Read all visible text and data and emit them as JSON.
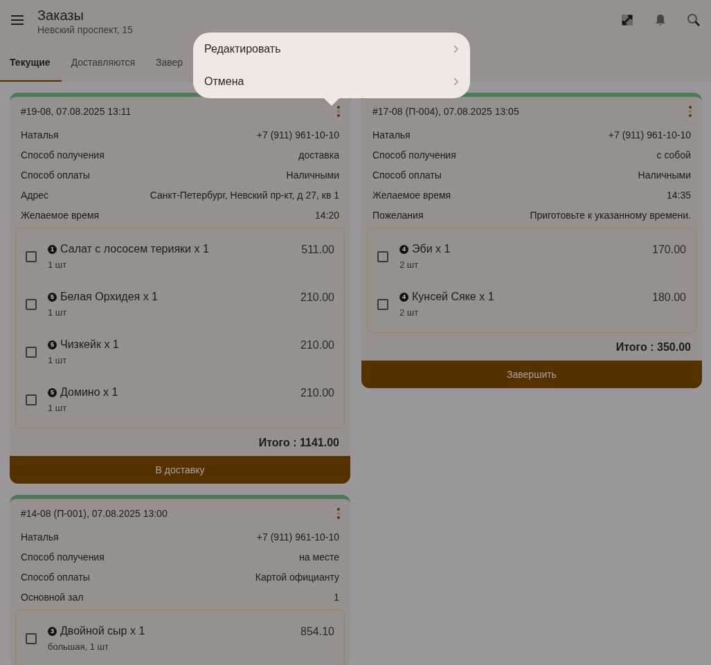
{
  "app_bar": {
    "title": "Заказы",
    "subtitle": "Невский проспект, 15"
  },
  "tabs": [
    {
      "label": "Текущие",
      "selected": true
    },
    {
      "label": "Доставляются",
      "selected": false
    },
    {
      "label": "Завер",
      "selected": false
    }
  ],
  "menu": {
    "items": [
      "Редактировать",
      "Отмена"
    ]
  },
  "columns": [
    [
      {
        "header": "#19-08, 07.08.2025 13:11",
        "fields": [
          {
            "label": "Наталья",
            "value": "+7 (911) 961-10-10"
          },
          {
            "label": "Способ получения",
            "value": "доставка"
          },
          {
            "label": "Способ оплаты",
            "value": "Наличными"
          },
          {
            "label": "Адрес",
            "value": "Санкт-Петербург, Невский пр-кт, д 27, кв 1"
          },
          {
            "label": "Желаемое время",
            "value": "14:20"
          }
        ],
        "items": [
          {
            "badge": "1",
            "name": "Салат с лососем терияки x 1",
            "details": "1 шт",
            "price": "511.00",
            "checked": false
          },
          {
            "badge": "5",
            "name": "Белая Орхидея x 1",
            "details": "1 шт",
            "price": "210.00",
            "checked": false
          },
          {
            "badge": "5",
            "name": "Чизкейк x 1",
            "details": "1 шт",
            "price": "210.00",
            "checked": false
          },
          {
            "badge": "5",
            "name": "Домино x 1",
            "details": "1 шт",
            "price": "210.00",
            "checked": false
          }
        ],
        "total": "Итого : 1141.00",
        "action": "В доставку"
      },
      {
        "header": "#14-08 (П-001), 07.08.2025 13:00",
        "fields": [
          {
            "label": "Наталья",
            "value": "+7 (911) 961-10-10"
          },
          {
            "label": "Способ получения",
            "value": "на месте"
          },
          {
            "label": "Способ оплаты",
            "value": "Картой официанту"
          },
          {
            "label": "Основной зал",
            "value": "1"
          }
        ],
        "items": [
          {
            "badge": "3",
            "name": "Двойной сыр x 1",
            "details": "большая, 1 шт",
            "price": "854.10",
            "checked": false
          }
        ]
      }
    ],
    [
      {
        "header": "#17-08 (П-004), 07.08.2025 13:05",
        "fields": [
          {
            "label": "Наталья",
            "value": "+7 (911) 961-10-10"
          },
          {
            "label": "Способ получения",
            "value": "с собой"
          },
          {
            "label": "Способ оплаты",
            "value": "Наличными"
          },
          {
            "label": "Желаемое время",
            "value": "14:35"
          },
          {
            "label": "Пожелания",
            "value": "Приготовьте к указанному времени."
          }
        ],
        "items": [
          {
            "badge": "4",
            "name": "Эби x 1",
            "details": "2 шт",
            "price": "170.00",
            "checked": false
          },
          {
            "badge": "4",
            "name": "Кунсей Сяке x 1",
            "details": "2 шт",
            "price": "180.00",
            "checked": false
          }
        ],
        "total": "Итого : 350.00",
        "action": "Завершить"
      }
    ]
  ]
}
